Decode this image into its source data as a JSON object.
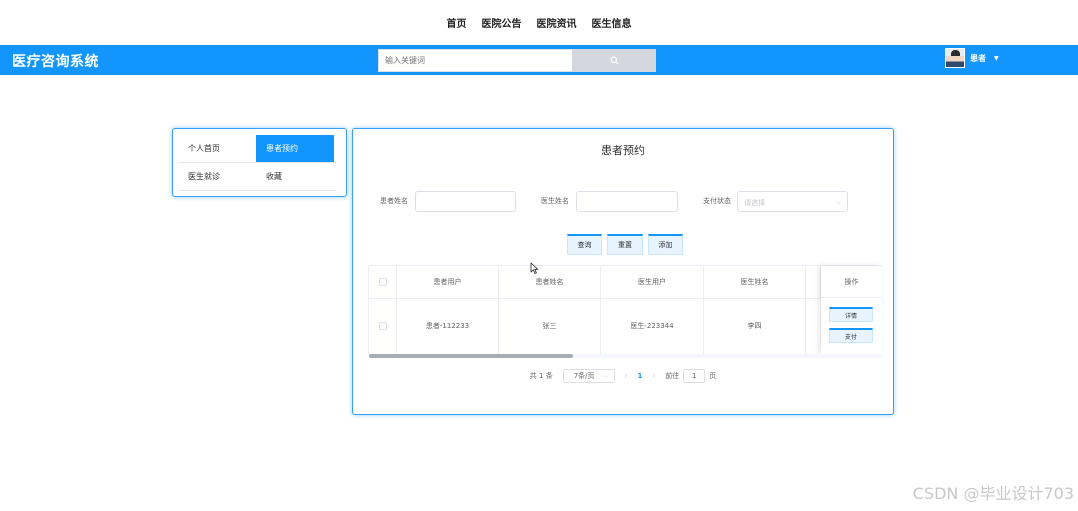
{
  "topnav": {
    "items": [
      "首页",
      "医院公告",
      "医院资讯",
      "医生信息"
    ]
  },
  "header": {
    "brand": "医疗咨询系统",
    "search_placeholder": "输入关键词",
    "user_name": "患者",
    "accent": "#1296fe"
  },
  "sidebar": {
    "items": [
      {
        "label": "个人首页",
        "active": false
      },
      {
        "label": "患者预约",
        "active": true
      },
      {
        "label": "医生就诊",
        "active": false
      },
      {
        "label": "收藏",
        "active": false
      }
    ]
  },
  "main": {
    "title": "患者预约",
    "filters": {
      "patient_name_label": "患者姓名",
      "doctor_name_label": "医生姓名",
      "pay_status_label": "支付状态",
      "pay_status_placeholder": "请选择"
    },
    "buttons": {
      "query": "查询",
      "reset": "重置",
      "add": "添加"
    },
    "table": {
      "columns": [
        "患者用户",
        "患者姓名",
        "医生用户",
        "医生姓名",
        "操作"
      ],
      "rows": [
        {
          "patient_user": "患者-112233",
          "patient_name": "张三",
          "doctor_user": "医生-223344",
          "doctor_name": "李四"
        }
      ],
      "row_actions": [
        "详情",
        "支付"
      ]
    },
    "pagination": {
      "total": "共 1 条",
      "page_size": "7条/页",
      "current_page": "1",
      "goto_label": "前往",
      "goto_value": "1",
      "page_unit": "页"
    }
  },
  "watermark": "CSDN @毕业设计703"
}
